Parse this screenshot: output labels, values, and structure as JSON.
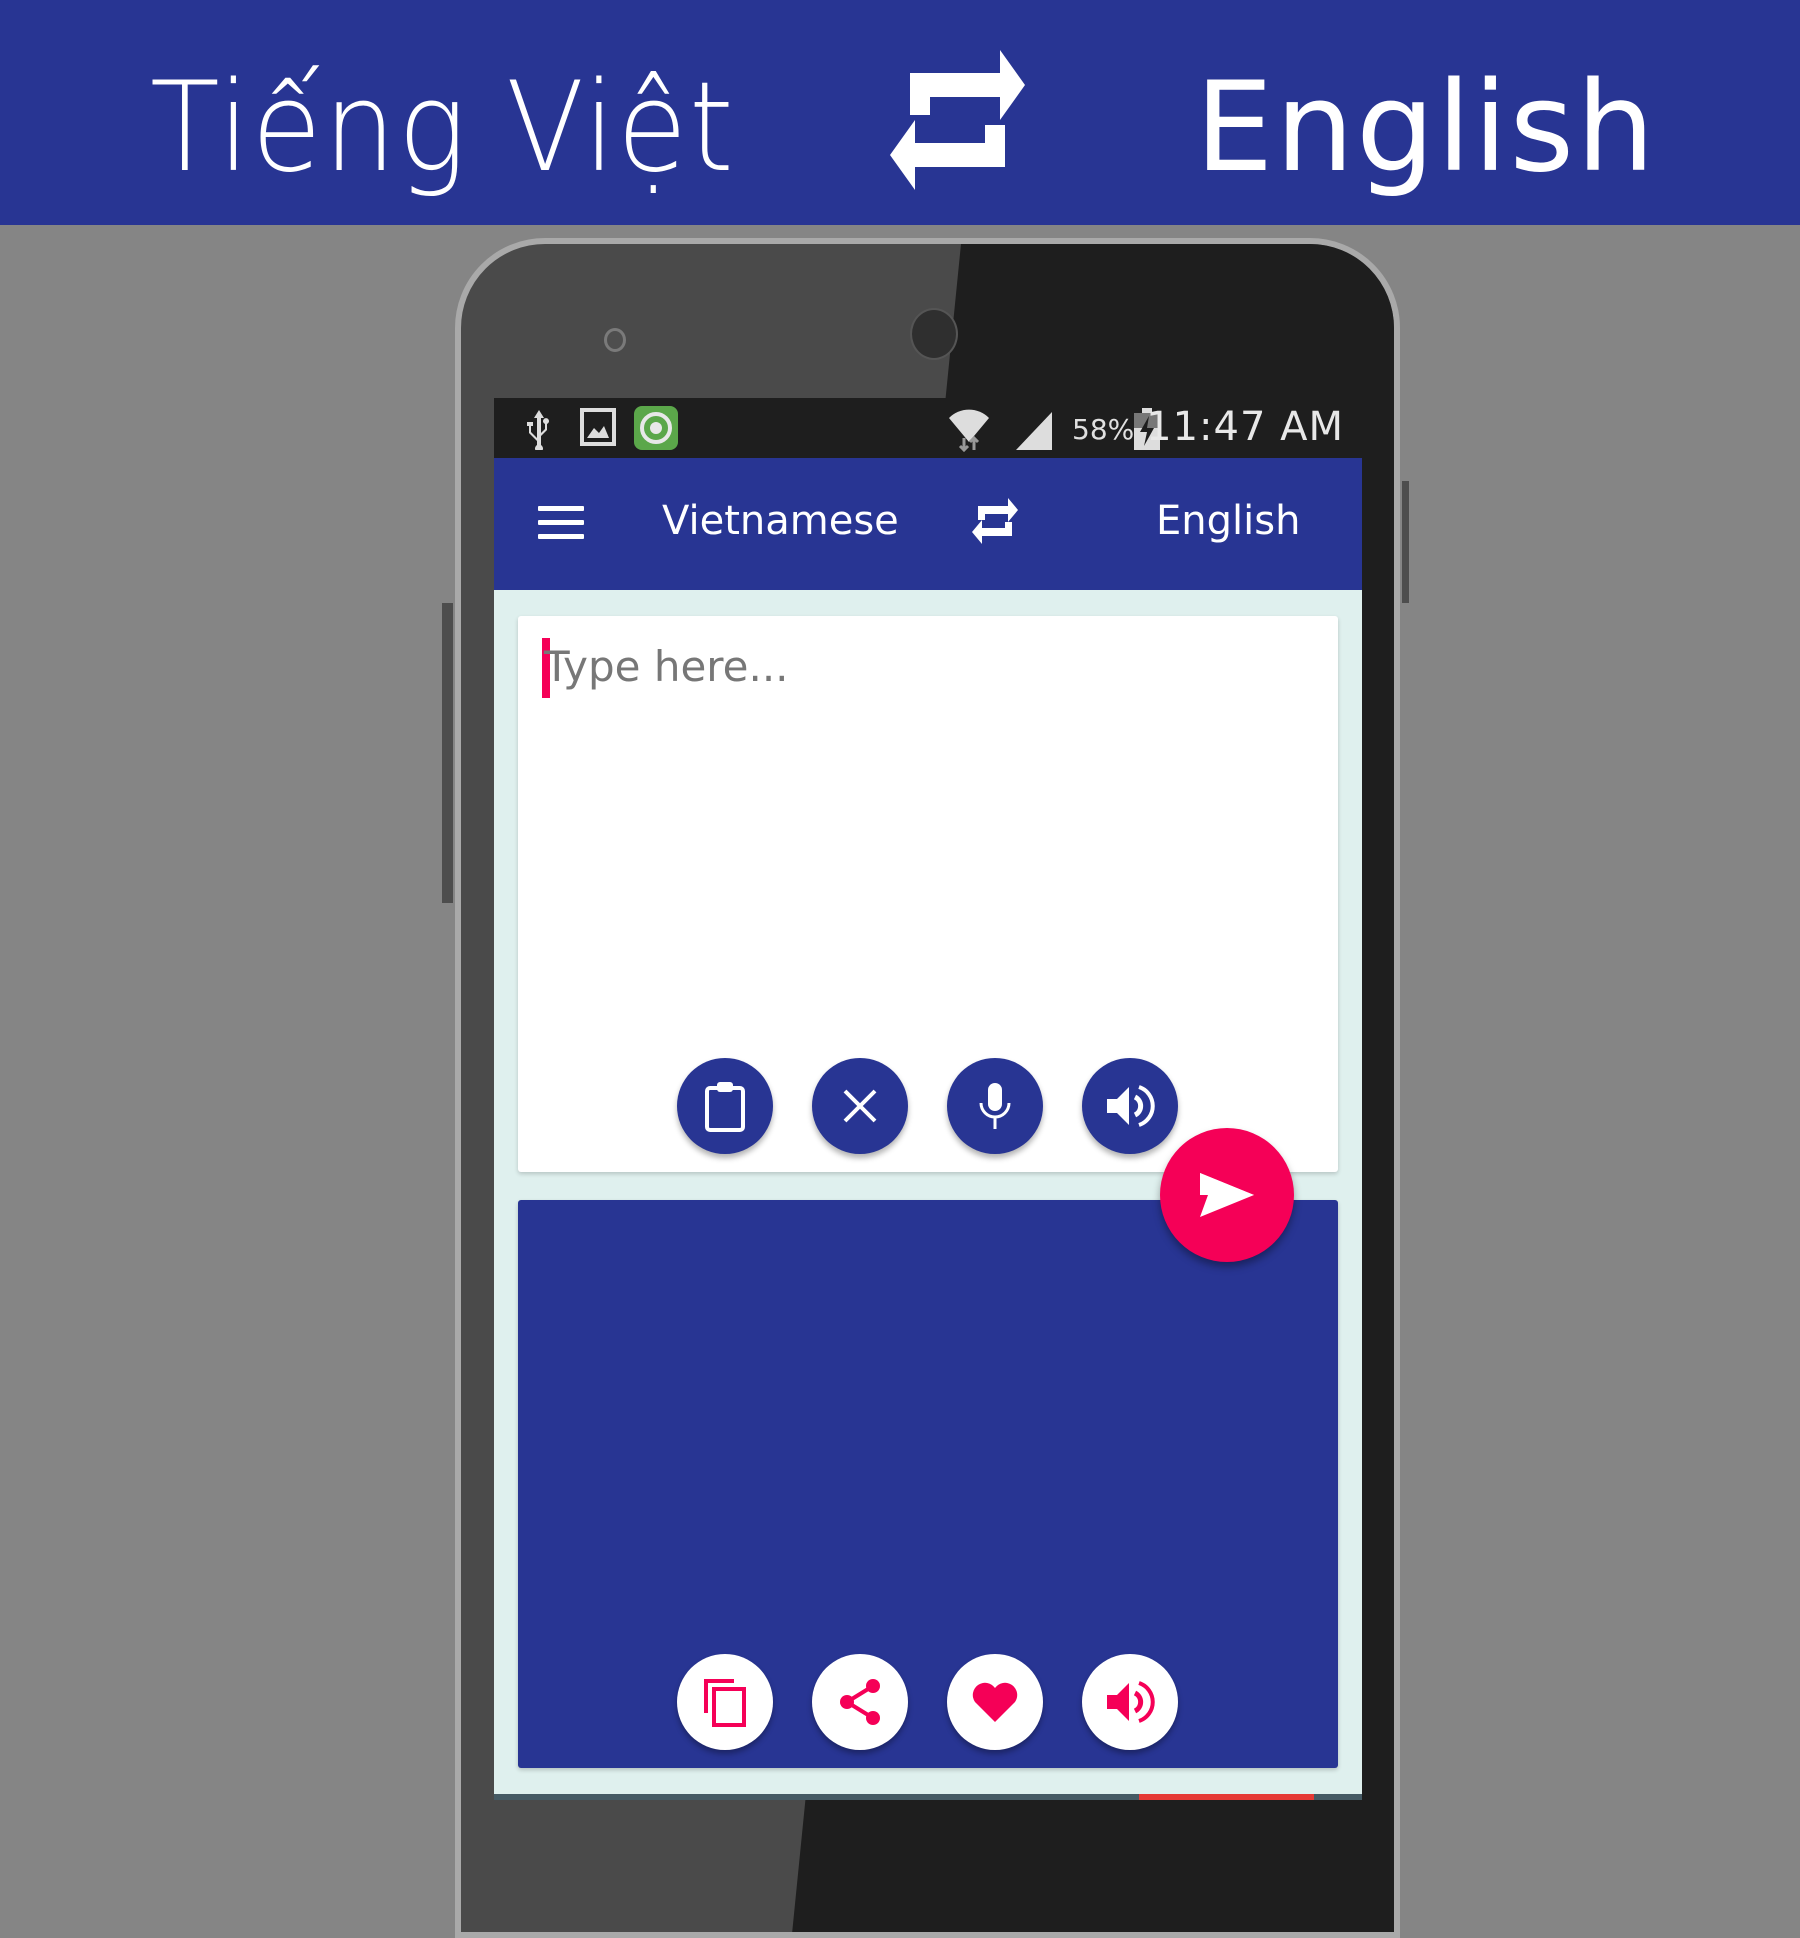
{
  "banner": {
    "source_language": "Tiếng Việt",
    "target_language": "English",
    "swap_icon": "swap-arrows-icon"
  },
  "status_bar": {
    "left_icons": [
      "usb-icon",
      "image-icon",
      "app-notification-icon"
    ],
    "right_icons": [
      "wifi-icon",
      "signal-icon",
      "battery-charging-icon"
    ],
    "battery": "58%",
    "time": "11:47 AM"
  },
  "toolbar": {
    "menu_icon": "hamburger-menu-icon",
    "source_language": "Vietnamese",
    "swap_icon": "swap-arrows-icon",
    "target_language": "English"
  },
  "input": {
    "value": "",
    "placeholder": "Type here...",
    "actions": [
      {
        "name": "paste",
        "icon": "clipboard-icon"
      },
      {
        "name": "clear",
        "icon": "close-icon"
      },
      {
        "name": "voice-input",
        "icon": "microphone-icon"
      },
      {
        "name": "speak-input",
        "icon": "speaker-icon"
      }
    ],
    "translate_button_icon": "send-icon"
  },
  "output": {
    "value": "",
    "actions": [
      {
        "name": "copy",
        "icon": "copy-icon"
      },
      {
        "name": "share",
        "icon": "share-icon"
      },
      {
        "name": "favorite",
        "icon": "heart-icon"
      },
      {
        "name": "speak-output",
        "icon": "speaker-icon"
      }
    ]
  },
  "colors": {
    "primary": "#283593",
    "accent": "#f50057",
    "background": "#dff0ee"
  }
}
